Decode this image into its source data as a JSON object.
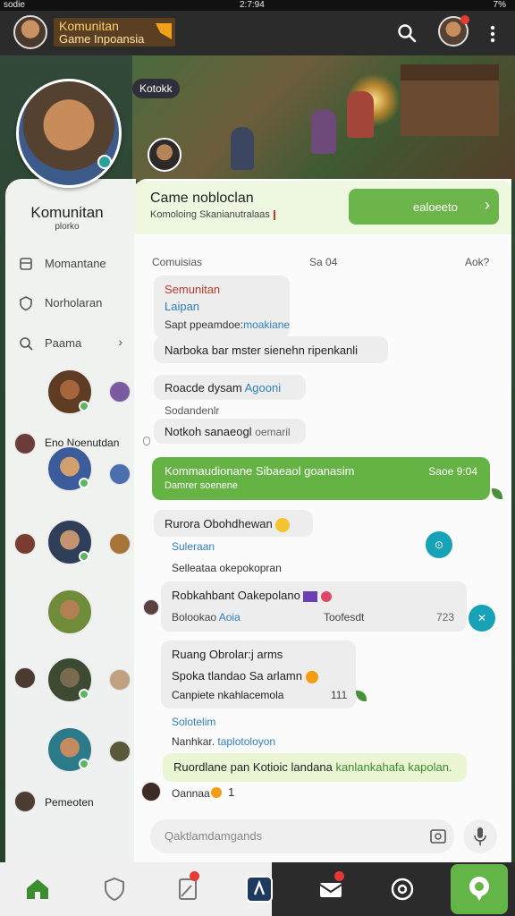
{
  "status_bar": {
    "left": "sodie",
    "time": "2:7:94",
    "right": "7%"
  },
  "header": {
    "title_line1": "Komunitan",
    "title_line2": "Game Inpoansia"
  },
  "banner": {
    "tag_label": "Kotokk"
  },
  "sidebar": {
    "profile_name": "Komunitan",
    "profile_sub": "plorko",
    "menu": [
      {
        "label": "Momantane",
        "icon": "square-icon"
      },
      {
        "label": "Norholaran",
        "icon": "shield-icon"
      },
      {
        "label": "Paama",
        "icon": "search-icon"
      }
    ],
    "section_label": "Eno Noenutdan",
    "bottom_label": "Pemeoten"
  },
  "game_card": {
    "title": "Came nobloclan",
    "subtitle": "Komoloing Skanianutralaas",
    "button_label": "ealoeeto"
  },
  "chat_list": {
    "header_left": "Comuisias",
    "header_mid": "Sa 04",
    "header_right": "Aok?"
  },
  "messages": {
    "m1_name": "Semunitan",
    "m1_sub": "Laipan",
    "m1_line": "Sapt ppeamdoe:",
    "m1_link": "moakiane",
    "m2_line": "Narboka bar mster sienehn ripenkanli",
    "m3_line1": "Roacde dysam",
    "m3_link": "Agooni",
    "m3_sub": "Sodandenlr",
    "m4_line": "Notkoh sanaeogl",
    "m4_sub": "oemaril",
    "green_title": "Kommaudionane Sibaeaol goanasim",
    "green_sub": "Damrer soenene",
    "green_time": "Saoe 9:04",
    "m5_line": "Rurora Obohdhewan",
    "m5_link": "Suleraan",
    "m5_sub": "Selleataa okepokopran",
    "m6_line": "Robkahbant Oakepolano",
    "m6_left": "Bolookao",
    "m6_link": "Aoia",
    "m6_mid": "Toofesdt",
    "m6_num": "723",
    "m7_line1": "Ruang Obrolar:j arms",
    "m7_line2": "Spoka tlandao Sa arlamn",
    "m7_line3": "Canpiete nkahlacemola",
    "m7_num": "111",
    "m7_link": "Solotelim",
    "m7_sub1": "Nanhkar.",
    "m7_link2": "taplotoloyon",
    "note_line": "Ruordlane pan Kotioic landana",
    "note_link": "kanlankahafa kapolan.",
    "footer_name": "Oannaa",
    "footer_num": "1"
  },
  "input": {
    "placeholder": "Qaktlamdamgands"
  },
  "colors": {
    "accent_green": "#66b345",
    "teal": "#17a2b8",
    "header_bg": "#2b2b2b"
  }
}
